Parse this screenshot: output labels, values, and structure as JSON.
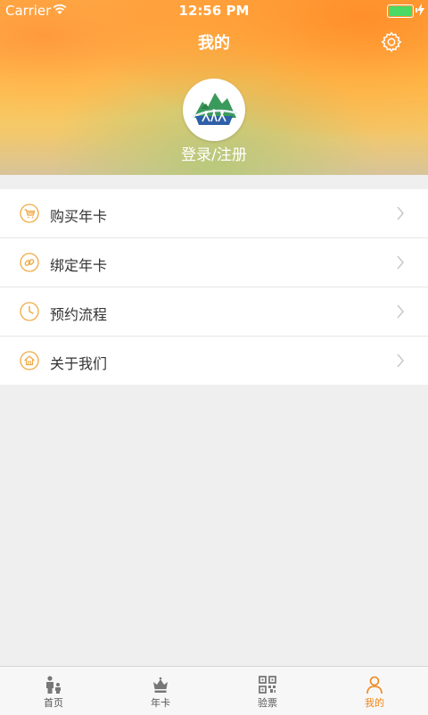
{
  "status_bar": {
    "carrier": "Carrier",
    "time": "12:56 PM",
    "battery_level": 1.0
  },
  "header": {
    "title": "我的",
    "settings_icon": "gear-icon",
    "avatar_icon": "mountain-logo-icon",
    "login_label": "登录/注册"
  },
  "colors": {
    "accent": "#f08519",
    "icon_ring": "#f0a840",
    "tab_inactive": "#555555"
  },
  "menu": {
    "items": [
      {
        "label": "购买年卡",
        "icon": "cart-icon"
      },
      {
        "label": "绑定年卡",
        "icon": "link-icon"
      },
      {
        "label": "预约流程",
        "icon": "clock-icon"
      },
      {
        "label": "关于我们",
        "icon": "home-icon"
      }
    ]
  },
  "tabbar": {
    "items": [
      {
        "label": "首页",
        "icon": "family-icon",
        "active": false
      },
      {
        "label": "年卡",
        "icon": "crown-icon",
        "active": false
      },
      {
        "label": "验票",
        "icon": "qr-code-icon",
        "active": false
      },
      {
        "label": "我的",
        "icon": "person-icon",
        "active": true
      }
    ]
  }
}
